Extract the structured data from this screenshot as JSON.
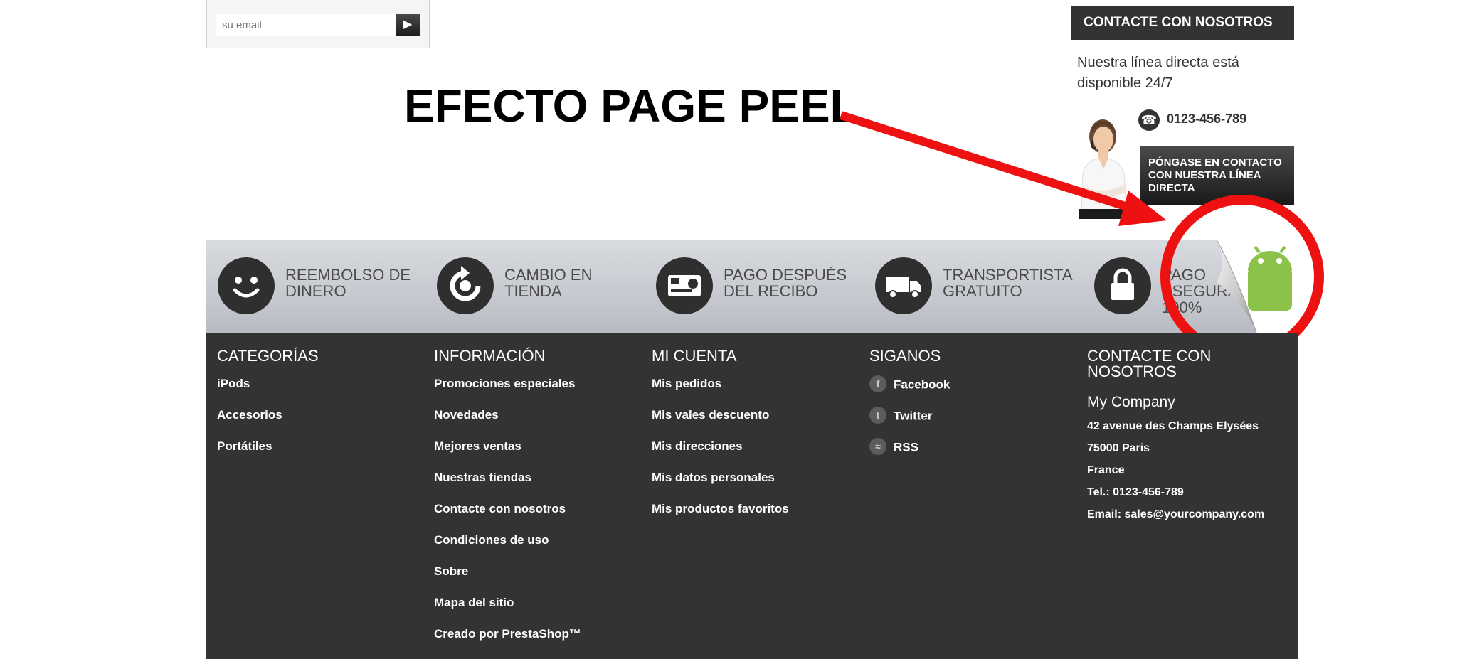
{
  "newsletter": {
    "placeholder": "su email",
    "submit_icon": "play-triangle-icon"
  },
  "annotation": {
    "title": "EFECTO PAGE PEEL",
    "color": "#ee1111"
  },
  "contact_block": {
    "header": "CONTACTE CON NOSOTROS",
    "description": "Nuestra línea directa está disponible 24/7",
    "phone": "0123-456-789",
    "cta": "PÓNGASE EN CONTACTO CON NUESTRA LÍNEA DIRECTA"
  },
  "reassurance": [
    {
      "icon": "smiley-icon",
      "label": "REEMBOLSO DE DINERO"
    },
    {
      "icon": "refresh-icon",
      "label": "CAMBIO EN TIENDA"
    },
    {
      "icon": "credit-card-icon",
      "label": "PAGO DESPUÉS DEL RECIBO"
    },
    {
      "icon": "truck-icon",
      "label": "TRANSPORTISTA GRATUITO"
    },
    {
      "icon": "lock-icon",
      "label": "PAGO ASEGURADO 100%"
    }
  ],
  "footer": {
    "categories": {
      "title": "CATEGORÍAS",
      "items": [
        "iPods",
        "Accesorios",
        "Portátiles"
      ]
    },
    "information": {
      "title": "INFORMACIÓN",
      "items": [
        "Promociones especiales",
        "Novedades",
        "Mejores ventas",
        "Nuestras tiendas",
        "Contacte con nosotros",
        "Condiciones de uso",
        "Sobre",
        "Mapa del sitio",
        "Creado por PrestaShop™"
      ]
    },
    "account": {
      "title": "MI CUENTA",
      "items": [
        "Mis pedidos",
        "Mis vales descuento",
        "Mis direcciones",
        "Mis datos personales",
        "Mis productos favoritos"
      ]
    },
    "follow": {
      "title": "SIGANOS",
      "items": [
        {
          "icon": "facebook-icon",
          "label": "Facebook"
        },
        {
          "icon": "twitter-icon",
          "label": "Twitter"
        },
        {
          "icon": "rss-icon",
          "label": "RSS"
        }
      ]
    },
    "contact": {
      "title": "CONTACTE CON NOSOTROS",
      "company": "My Company",
      "address1": "42 avenue des Champs Elysées",
      "address2": "75000 Paris",
      "country": "France",
      "tel": "Tel.: 0123-456-789",
      "email": "Email: sales@yourcompany.com"
    }
  }
}
